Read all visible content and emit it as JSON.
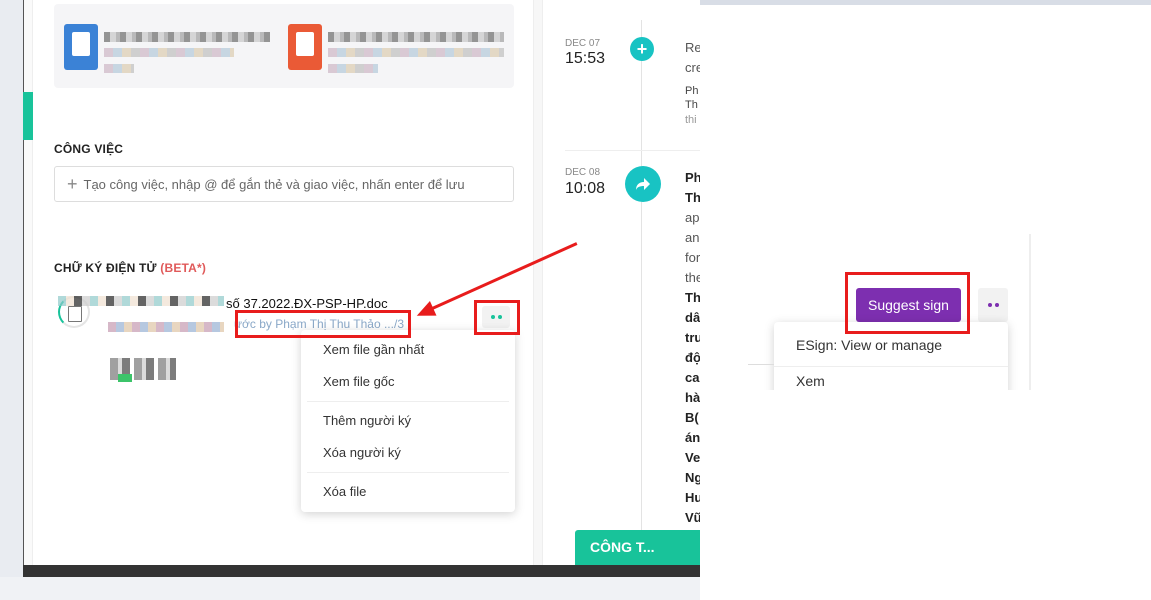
{
  "attachments": {
    "files": [
      {
        "icon": "word-document-icon"
      },
      {
        "icon": "pdf-document-icon"
      }
    ]
  },
  "tasks": {
    "title": "CÔNG VIỆC",
    "input_placeholder": "Tạo công việc, nhập @ để gắn thẻ và giao việc, nhấn enter để lưu"
  },
  "esign": {
    "title": "CHỮ KÝ ĐIỆN TỬ",
    "beta": "(BETA*)",
    "document_name": "số 37.2022.ĐX-PSP-HP.doc",
    "document_sub": "ước by Phạm Thị Thu Thảo  .../3"
  },
  "context_menu": {
    "items": [
      {
        "label": "Xem file gần nhất"
      },
      {
        "label": "Xem file gốc"
      },
      {
        "label": "Thêm người ký"
      },
      {
        "label": "Xóa người ký"
      },
      {
        "label": "Xóa file"
      }
    ]
  },
  "timeline": {
    "entries": [
      {
        "date": "DEC 07",
        "time": "15:53",
        "icon": "plus-icon"
      },
      {
        "date": "DEC 08",
        "time": "10:08",
        "icon": "share-arrow-icon"
      }
    ],
    "entry1_lines": [
      "Re",
      "cre"
    ],
    "entry1_small": [
      "Ph",
      "Th"
    ],
    "entry1_muted": "thi",
    "entry2_bold_top": [
      "Ph",
      "Th"
    ],
    "entry2_lines": [
      "ap",
      "an",
      "for",
      "the"
    ],
    "entry2_bold": [
      "Th",
      "dâ",
      "tru",
      "độ",
      "ca",
      "hà",
      "B(",
      "án",
      "Ve",
      "Ng",
      "Hu",
      "Vũ"
    ]
  },
  "footer_button": "CÔNG T...",
  "inset": {
    "suggest_sign": "Suggest sign",
    "menu": [
      {
        "label": "ESign: View or manage"
      },
      {
        "label": "Xem"
      }
    ]
  },
  "colors": {
    "accent": "#18c39a",
    "annotation": "#e81c1c",
    "suggest": "#7d2fb0"
  }
}
